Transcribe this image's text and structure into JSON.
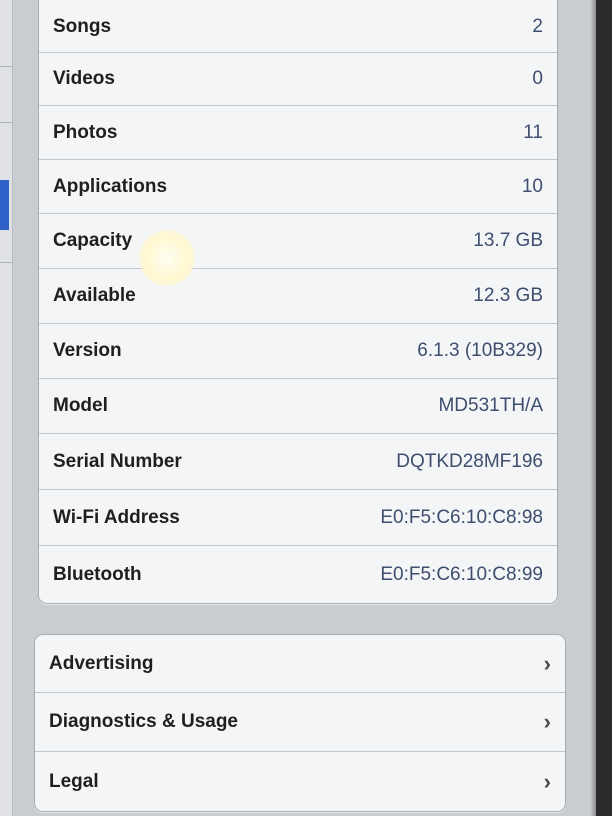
{
  "about": {
    "rows": [
      {
        "label": "Songs",
        "value": "2"
      },
      {
        "label": "Videos",
        "value": "0"
      },
      {
        "label": "Photos",
        "value": "11"
      },
      {
        "label": "Applications",
        "value": "10"
      },
      {
        "label": "Capacity",
        "value": "13.7 GB"
      },
      {
        "label": "Available",
        "value": "12.3 GB"
      },
      {
        "label": "Version",
        "value": "6.1.3 (10B329)"
      },
      {
        "label": "Model",
        "value": "MD531TH/A"
      },
      {
        "label": "Serial Number",
        "value": "DQTKD28MF196"
      },
      {
        "label": "Wi-Fi Address",
        "value": "E0:F5:C6:10:C8:98"
      },
      {
        "label": "Bluetooth",
        "value": "E0:F5:C6:10:C8:99"
      }
    ]
  },
  "links": {
    "rows": [
      {
        "label": "Advertising",
        "chevron": "›"
      },
      {
        "label": "Diagnostics & Usage",
        "chevron": "›"
      },
      {
        "label": "Legal",
        "chevron": "›"
      }
    ]
  },
  "icons": {
    "disclosure": "chevron-right-icon"
  }
}
